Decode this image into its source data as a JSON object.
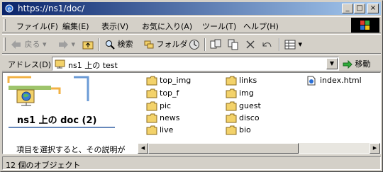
{
  "window": {
    "title": "https://ns1/doc/"
  },
  "menu": [
    "ファイル(F)",
    "編集(E)",
    "表示(V)",
    "お気に入り(A)",
    "ツール(T)",
    "ヘルプ(H)"
  ],
  "toolbar": {
    "back": "戻る",
    "search": "検索",
    "folders": "フォルダ"
  },
  "address": {
    "label": "アドレス(D)",
    "value": "ns1 上の test",
    "go": "移動"
  },
  "panel": {
    "title": "ns1 上の doc (2)",
    "description": "項目を選択すると、その説明が"
  },
  "files": [
    {
      "name": "top_img",
      "type": "folder"
    },
    {
      "name": "top_f",
      "type": "folder"
    },
    {
      "name": "pic",
      "type": "folder"
    },
    {
      "name": "news",
      "type": "folder"
    },
    {
      "name": "live",
      "type": "folder"
    },
    {
      "name": "links",
      "type": "folder"
    },
    {
      "name": "img",
      "type": "folder"
    },
    {
      "name": "guest",
      "type": "folder"
    },
    {
      "name": "disco",
      "type": "folder"
    },
    {
      "name": "bio",
      "type": "folder"
    },
    {
      "name": "index.html",
      "type": "html"
    }
  ],
  "status": {
    "text": "12 個のオブジェクト"
  },
  "colors": {
    "title_start": "#0a246a",
    "title_end": "#a6caf0",
    "folder": "#f3d26a"
  }
}
